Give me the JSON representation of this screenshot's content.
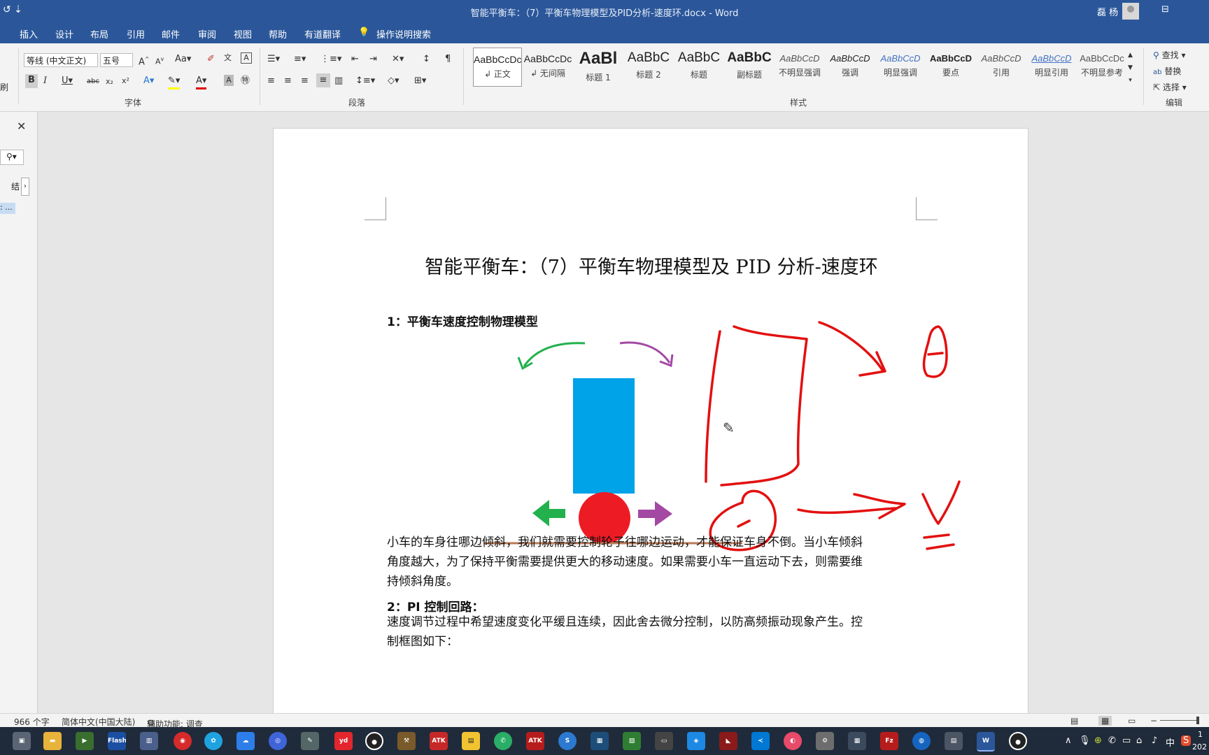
{
  "app": {
    "window_title": "智能平衡车：（7）平衡车物理模型及PID分析-速度环.docx  -  Word",
    "user_name": "磊 杨"
  },
  "menu_tabs": [
    "插入",
    "设计",
    "布局",
    "引用",
    "邮件",
    "审阅",
    "视图",
    "帮助",
    "有道翻译"
  ],
  "tell_me": "操作说明搜索",
  "ribbon": {
    "font_name": "等线 (中文正文)",
    "font_size": "五号",
    "font_group_label": "字体",
    "paragraph_group_label": "段落",
    "styles_group_label": "样式",
    "editing_group_label": "编辑",
    "left_cut_label": "刷",
    "styles": [
      {
        "preview": "AaBbCcDc",
        "label": "↲ 正文"
      },
      {
        "preview": "AaBbCcDc",
        "label": "↲ 无间隔"
      },
      {
        "preview": "AaBl",
        "label": "标题 1"
      },
      {
        "preview": "AaBbC",
        "label": "标题 2"
      },
      {
        "preview": "AaBbC",
        "label": "标题"
      },
      {
        "preview": "AaBbC",
        "label": "副标题"
      },
      {
        "preview": "AaBbCcD",
        "label": "不明显强调"
      },
      {
        "preview": "AaBbCcD",
        "label": "强调"
      },
      {
        "preview": "AaBbCcD",
        "label": "明显强调"
      },
      {
        "preview": "AaBbCcD",
        "label": "要点"
      },
      {
        "preview": "AaBbCcD",
        "label": "引用"
      },
      {
        "preview": "AaBbCcD",
        "label": "明显引用"
      },
      {
        "preview": "AaBbCcDc",
        "label": "不明显参考"
      }
    ],
    "editing": {
      "find": "查找",
      "replace": "替换",
      "select": "选择"
    }
  },
  "nav_pane": {
    "label_cut": "结",
    "item_cut": ": ..."
  },
  "document": {
    "title": "智能平衡车：（7）平衡车物理模型及 PID 分析-速度环",
    "heading1": "1：平衡车速度控制物理模型",
    "para1_lines": [
      "小车的车身往哪边倾斜，我们就需要控制轮子往哪边运动，才能保证车身不倒。当小车倾斜",
      "角度越大，为了保持平衡需要提供更大的移动速度。如果需要小车一直运动下去，则需要维",
      "持倾斜角度。"
    ],
    "heading2": "2：PI 控制回路：",
    "para2_lines": [
      "速度调节过程中希望速度变化平缓且连续，因此舍去微分控制，以防高频振动现象产生。控",
      "制框图如下："
    ]
  },
  "colors": {
    "title_bar": "#2b579a",
    "car_body": "#00a2e8",
    "wheel": "#ed1c24",
    "left_arrow": "#22b14c",
    "right_arrow": "#a349a4",
    "ground": "#b97a57",
    "annotation": "#e31010"
  },
  "status": {
    "word_count": "966 个字",
    "language": "简体中文(中国大陆)",
    "accessibility": "辅助功能: 调查"
  },
  "taskbar": {
    "apps": [
      "Flash",
      "yd",
      "ATK",
      "ATK PID"
    ],
    "tray": {
      "ime": "中",
      "time": "1",
      "date": "202"
    }
  }
}
